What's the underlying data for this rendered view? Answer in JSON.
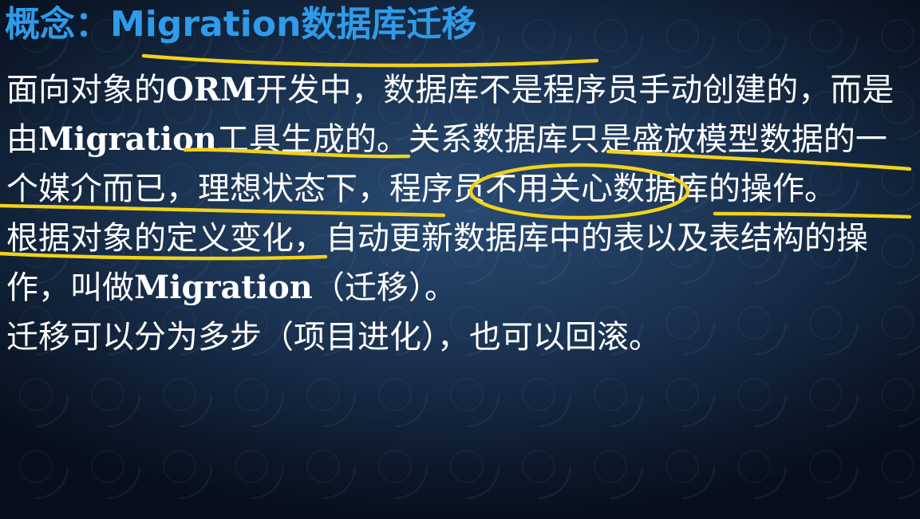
{
  "slide": {
    "title": "概念：Migration数据库迁移",
    "paragraphs": [
      {
        "runs": [
          {
            "text": "面向对象的",
            "bold": false
          },
          {
            "text": "ORM",
            "bold": true
          },
          {
            "text": "开发中，数据库不是程序员手动创建的，而是由",
            "bold": false
          },
          {
            "text": "Migration",
            "bold": true
          },
          {
            "text": "工具生成的。关系数据库只是盛放模型数据的一个媒介而已，理想状态下，程序员不用关心数据库的操作。",
            "bold": false
          }
        ]
      },
      {
        "runs": [
          {
            "text": "根据对象的定义变化，自动更新数据库中的表以及表结构的操作，叫做",
            "bold": false
          },
          {
            "text": "Migration",
            "bold": true
          },
          {
            "text": "（迁移）。",
            "bold": false
          }
        ]
      },
      {
        "runs": [
          {
            "text": "迁移可以分为多步（项目进化），也可以回滚。",
            "bold": false
          }
        ]
      }
    ]
  },
  "colors": {
    "title": "#2f9be9",
    "text": "#ffffff",
    "annotation": "#f2d21a"
  }
}
